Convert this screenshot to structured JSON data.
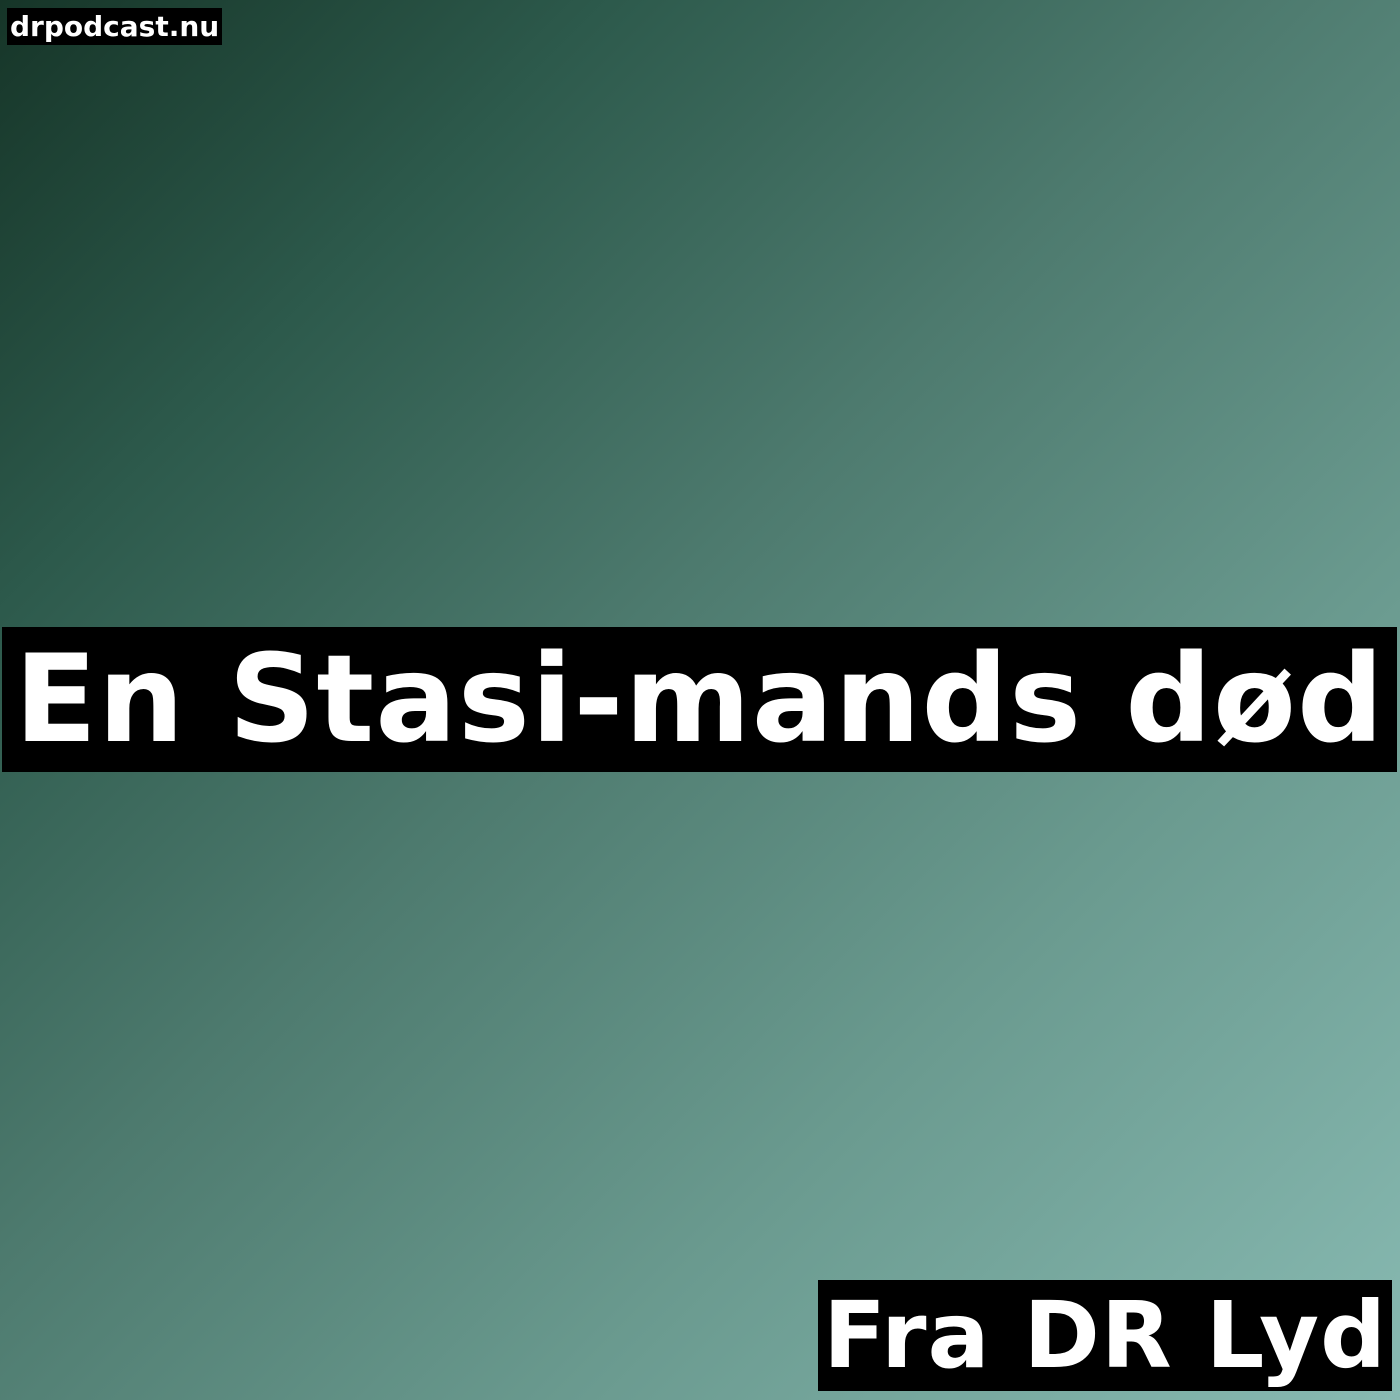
{
  "cover": {
    "site": "drpodcast.nu",
    "title": "En Stasi-mands død",
    "source": "Fra DR Lyd",
    "colors": {
      "gradient_dark": "#163528",
      "gradient_light": "#88bab2",
      "band": "#000000",
      "text": "#ffffff"
    }
  }
}
